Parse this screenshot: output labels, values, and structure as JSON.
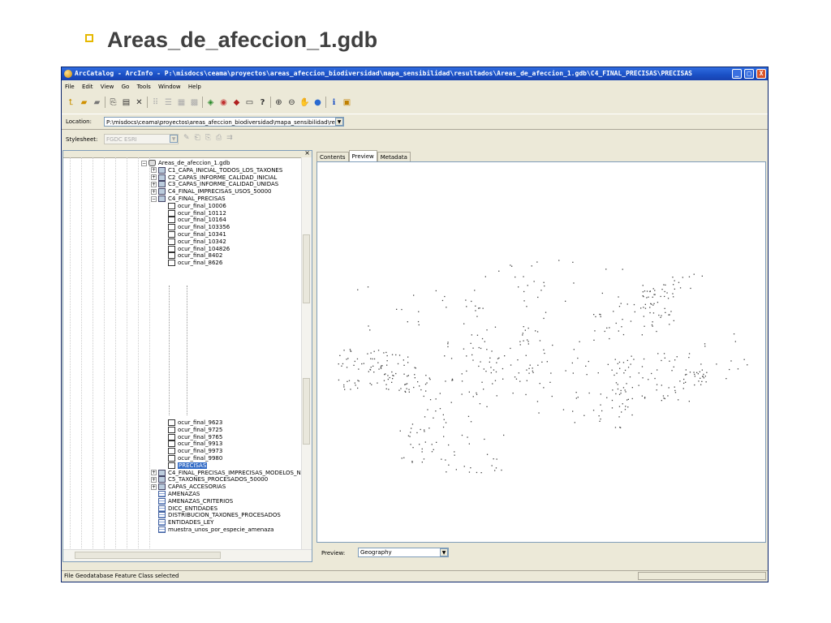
{
  "slide": {
    "title": "Areas_de_afeccion_1.gdb"
  },
  "window": {
    "title": "ArcCatalog - ArcInfo - P:\\misdocs\\ceama\\proyectos\\areas_afeccion_biodiversidad\\mapa_sensibilidad\\resultados\\Areas_de_afeccion_1.gdb\\C4_FINAL_PRECISAS\\PRECISAS",
    "minimize": "_",
    "maximize": "□",
    "close": "X"
  },
  "menu": [
    "File",
    "Edit",
    "View",
    "Go",
    "Tools",
    "Window",
    "Help"
  ],
  "toolbar_icons": [
    "up-one-level-icon",
    "connect-folder-icon",
    "disconnect-folder-icon",
    "copy-icon",
    "paste-icon",
    "delete-icon",
    "large-icons-icon",
    "list-icon",
    "details-icon",
    "thumbnails-icon",
    "launch-arcmap-icon",
    "arctoolbox-icon",
    "model-builder-icon",
    "metadata-icon",
    "whats-this-icon",
    "zoom-in-icon",
    "zoom-out-icon",
    "pan-icon",
    "full-extent-icon",
    "identify-icon",
    "create-thumbnail-icon"
  ],
  "location": {
    "label": "Location:",
    "value": "P:\\misdocs\\ceama\\proyectos\\areas_afeccion_biodiversidad\\mapa_sensibilidad\\result"
  },
  "stylesheet": {
    "label": "Stylesheet:",
    "value": "FGDC ESRI"
  },
  "tree": {
    "root": "Areas_de_afeccion_1.gdb",
    "datasets_top": [
      "C1_CAPA_INICIAL_TODOS_LOS_TAXONES",
      "C2_CAPAS_INFORME_CALIDAD_INICIAL",
      "C3_CAPAS_INFORME_CALIDAD_UNIDAS",
      "C4_FINAL_IMPRECISAS_USOS_50000"
    ],
    "open_dataset": "C4_FINAL_PRECISAS",
    "children_top": [
      "ocur_final_10006",
      "ocur_final_10112",
      "ocur_final_10164",
      "ocur_final_103356",
      "ocur_final_10341",
      "ocur_final_10342",
      "ocur_final_104826",
      "ocur_final_8402",
      "ocur_final_8626"
    ],
    "children_bottom": [
      "ocur_final_9623",
      "ocur_final_9725",
      "ocur_final_9765",
      "ocur_final_9913",
      "ocur_final_9973",
      "ocur_final_9980"
    ],
    "selected": "PRECISAS",
    "datasets_bottom": [
      "C4_FINAL_PRECISAS_IMPRECISAS_MODELOS_N",
      "C5_TAXONES_PROCESADOS_50000",
      "CAPAS_ACCESORIAS"
    ],
    "tables": [
      "AMENAZAS",
      "AMENAZAS_CRITERIOS",
      "DICC_ENTIDADES",
      "DISTRIBUCION_TAXONES_PROCESADOS",
      "ENTIDADES_LEY",
      "muestra_unos_por_especie_amenaza"
    ]
  },
  "tabs": [
    "Contents",
    "Preview",
    "Metadata"
  ],
  "active_tab": "Preview",
  "preview": {
    "label": "Preview:",
    "value": "Geography"
  },
  "status": "File Geodatabase Feature Class selected",
  "colors": {
    "title_bar": "#1a4fc4",
    "selection": "#316ac5",
    "points": "#444444"
  }
}
